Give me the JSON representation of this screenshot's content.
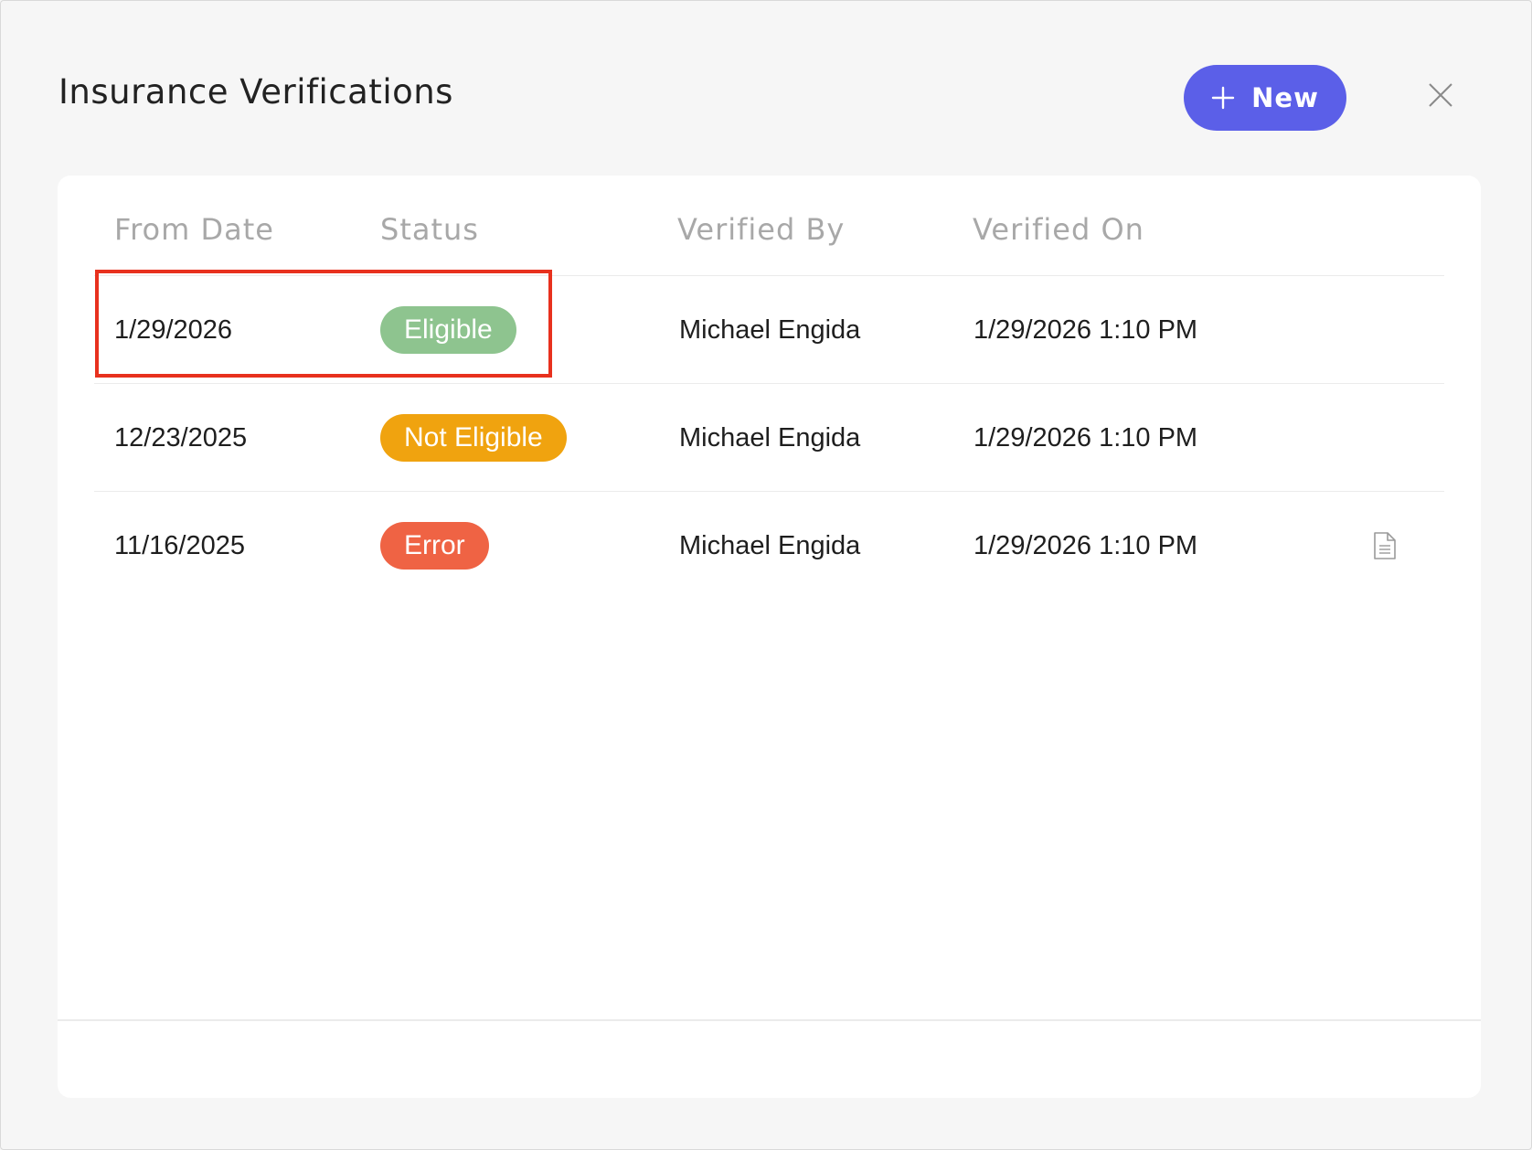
{
  "modal": {
    "title": "Insurance Verifications",
    "new_button_label": "New",
    "icons": {
      "new": "plus-icon",
      "close": "close-icon",
      "document": "document-icon"
    }
  },
  "table": {
    "columns": [
      "From Date",
      "Status",
      "Verified By",
      "Verified On"
    ],
    "rows": [
      {
        "from_date": "1/29/2026",
        "status": "Eligible",
        "status_color": "#8ec48f",
        "verified_by": "Michael Engida",
        "verified_on": "1/29/2026 1:10 PM",
        "has_document": false
      },
      {
        "from_date": "12/23/2025",
        "status": "Not Eligible",
        "status_color": "#f0a30f",
        "verified_by": "Michael Engida",
        "verified_on": "1/29/2026 1:10 PM",
        "has_document": false
      },
      {
        "from_date": "11/16/2025",
        "status": "Error",
        "status_color": "#ef6344",
        "verified_by": "Michael Engida",
        "verified_on": "1/29/2026 1:10 PM",
        "has_document": true
      }
    ]
  },
  "colors": {
    "accent": "#5b5fe8",
    "highlight": "#e8311e",
    "background": "#f6f6f6",
    "card": "#ffffff"
  }
}
